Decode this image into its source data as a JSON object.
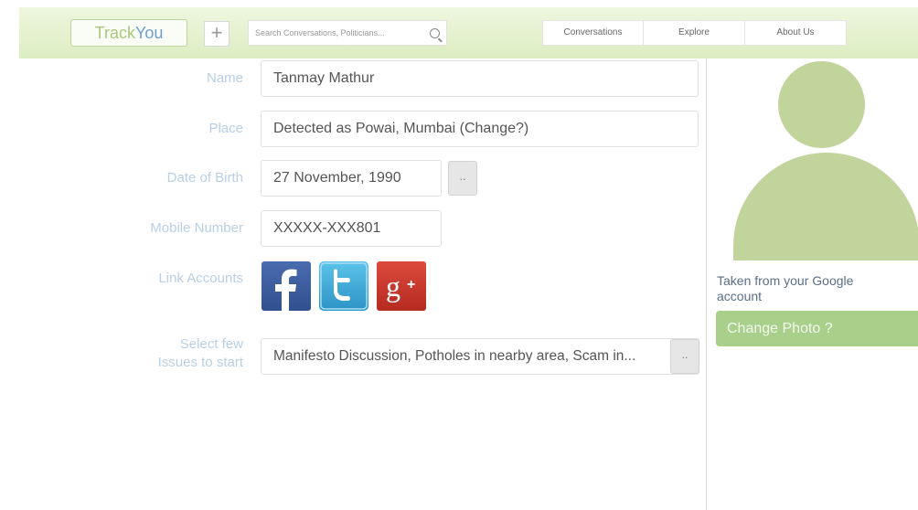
{
  "header": {
    "logo_part1": "Track",
    "logo_part2": "You",
    "add_button": "+",
    "search_placeholder": "Search Conversations, Politicians...",
    "search_icon": "search-icon",
    "nav": [
      "Conversations",
      "Explore",
      "About Us"
    ]
  },
  "form": {
    "name_label": "Name",
    "name_value": "Tanmay Mathur",
    "place_label": "Place",
    "place_value": "Detected as Powai, Mumbai (Change?)",
    "dob_label": "Date of Birth",
    "dob_value": "27 November, 1990",
    "dob_button": "..",
    "mobile_label": "Mobile Number",
    "mobile_value": "XXXXX-XXX801",
    "link_label": "Link Accounts",
    "social": [
      {
        "name": "Facebook",
        "icon": "facebook-icon",
        "color": "#3b5a9a"
      },
      {
        "name": "Twitter",
        "icon": "twitter-icon",
        "color": "#3aa9d8"
      },
      {
        "name": "Google+",
        "icon": "google-plus-icon",
        "color": "#c9302c"
      }
    ],
    "issues_label_line1": "Select few",
    "issues_label_line2": "Issues to start",
    "issues_value": "Manifesto Discussion, Potholes in nearby area, Scam in...",
    "issues_button": ".."
  },
  "profile": {
    "photo_note": "Taken from your Google account",
    "change_photo": "Change Photo ?"
  },
  "colors": {
    "header_green": "#dcedc2",
    "label_blue": "#b7d0e6",
    "avatar_green": "#c1d49b",
    "button_green": "#a8d08a"
  }
}
